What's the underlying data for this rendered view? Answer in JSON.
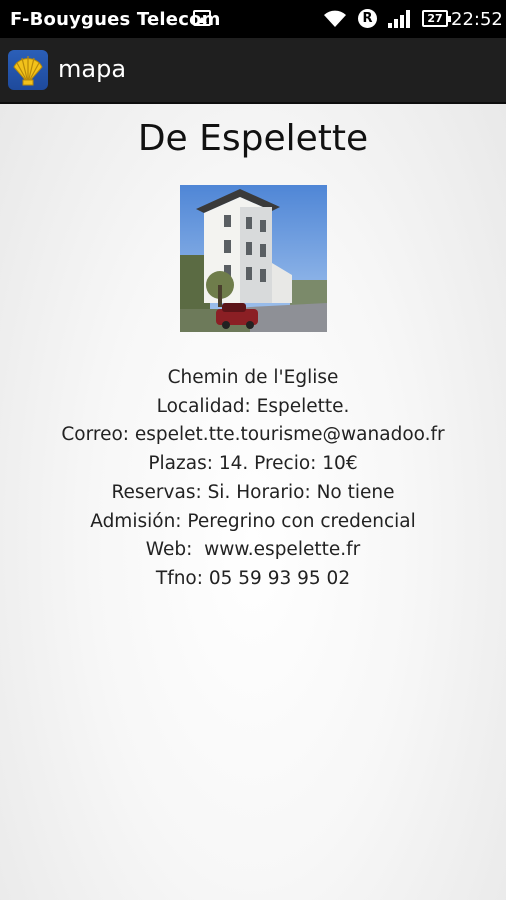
{
  "status_bar": {
    "carrier": "F-Bouygues Telecom",
    "battery_level": "27",
    "time": "22:52",
    "icons": [
      "image-notification-icon",
      "wifi-icon",
      "roaming-r-icon",
      "signal-icon",
      "battery-icon"
    ]
  },
  "action_bar": {
    "title": "mapa",
    "icon": "scallop-shell-icon"
  },
  "page": {
    "title": "De Espelette",
    "photo": "building-photo",
    "info_lines": [
      "Chemin de l'Eglise",
      "Localidad: Espelette.",
      "Correo: espelet.tte.tourisme@wanadoo.fr",
      "Plazas: 14. Precio: 10€",
      "Reservas: Si. Horario: No tiene",
      "Admisión: Peregrino con credencial",
      "Web:  www.espelette.fr",
      "Tfno: 05 59 93 95 02"
    ]
  },
  "colors": {
    "status_bar_bg": "#000000",
    "action_bar_bg": "#1f1f1f",
    "app_icon_bg": "#2457b0",
    "shell_yellow": "#f2c21b",
    "text": "#222222"
  }
}
